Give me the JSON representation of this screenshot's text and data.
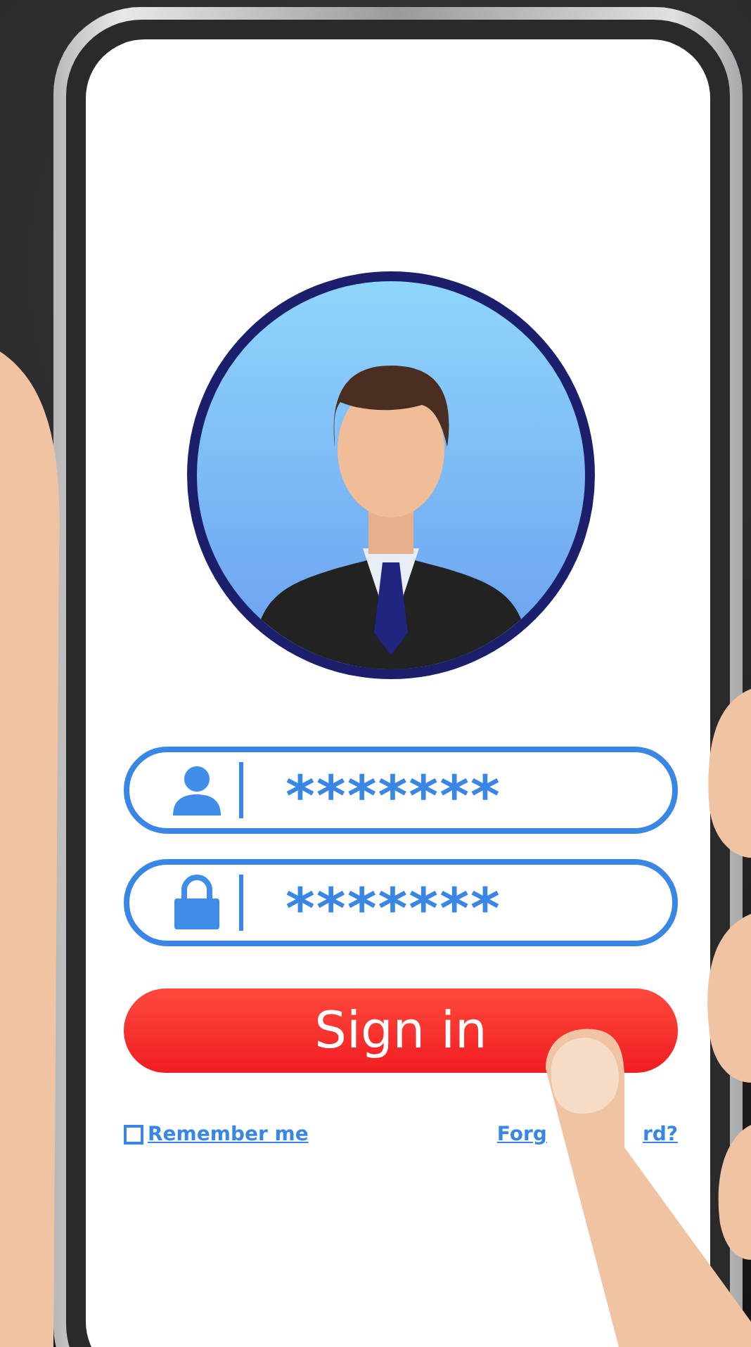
{
  "fields": [
    {
      "kind": "user",
      "value": "*******"
    },
    {
      "kind": "password",
      "value": "*******"
    }
  ],
  "sign_in_button": "Sign in",
  "remember": {
    "label": "Remember me",
    "checked": false
  },
  "forgot_link": {
    "visible_parts": [
      "Forg",
      "rd?"
    ]
  }
}
